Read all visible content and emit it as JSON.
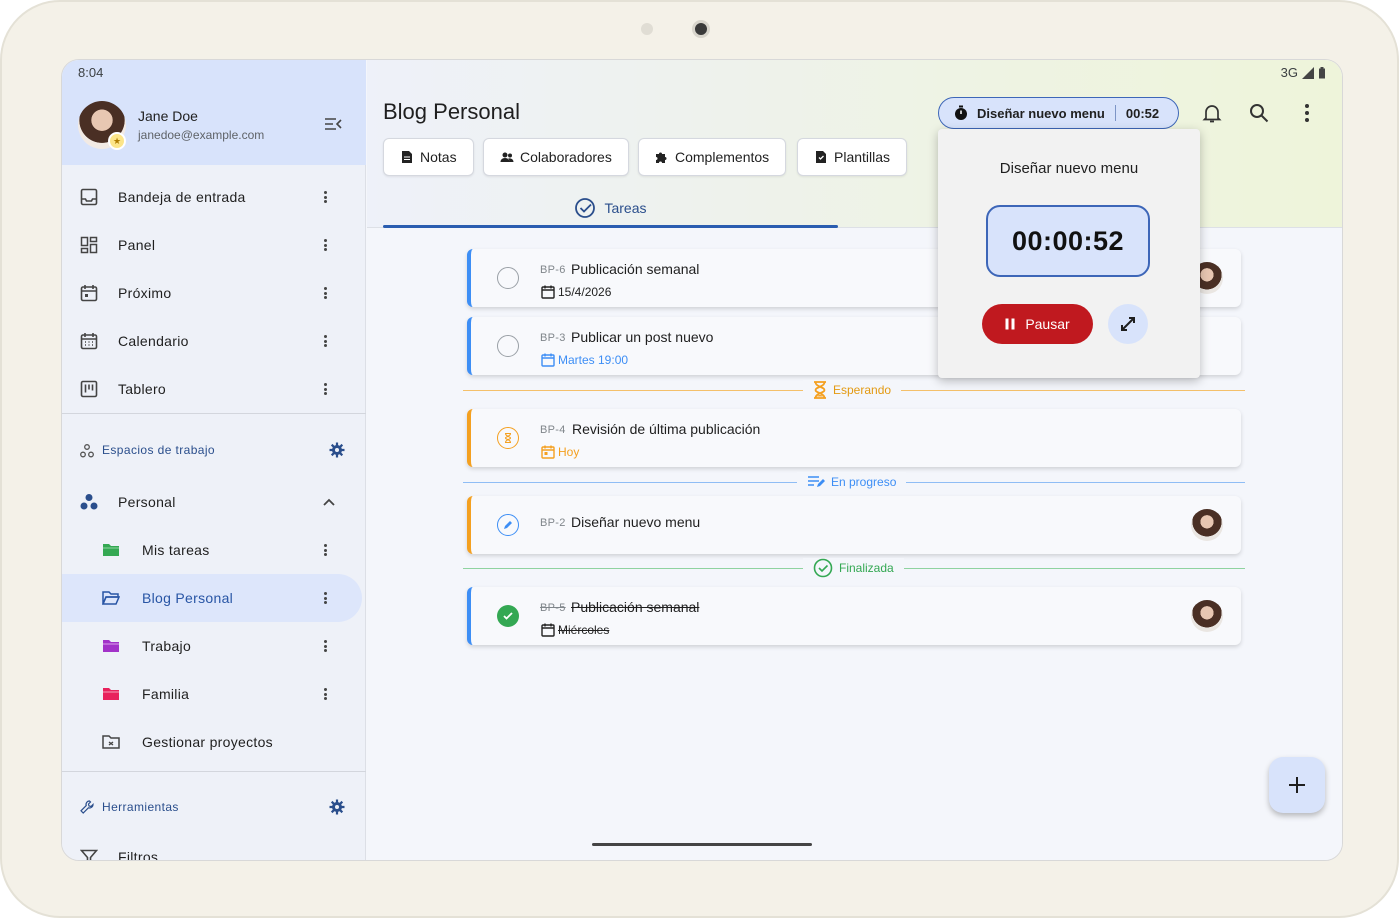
{
  "status": {
    "time": "8:04",
    "network": "3G"
  },
  "user": {
    "name": "Jane Doe",
    "email": "janedoe@example.com"
  },
  "sidebar": {
    "items": [
      {
        "label": "Bandeja de entrada",
        "icon": "inbox-icon"
      },
      {
        "label": "Panel",
        "icon": "dashboard-icon"
      },
      {
        "label": "Próximo",
        "icon": "calendar-upcoming-icon"
      },
      {
        "label": "Calendario",
        "icon": "calendar-icon"
      },
      {
        "label": "Tablero",
        "icon": "board-icon"
      }
    ],
    "workspaces_label": "Espacios de trabajo",
    "workspace": {
      "label": "Personal"
    },
    "projects": [
      {
        "label": "Mis tareas",
        "color": "#34a853"
      },
      {
        "label": "Blog Personal",
        "color": "#2855a5"
      },
      {
        "label": "Trabajo",
        "color": "#a233c9"
      },
      {
        "label": "Familia",
        "color": "#e8225c"
      }
    ],
    "manage_label": "Gestionar proyectos",
    "tools_label": "Herramientas",
    "filters_label": "Filtros"
  },
  "header": {
    "title": "Blog Personal",
    "chips": [
      "Notas",
      "Colaboradores",
      "Complementos",
      "Plantillas"
    ],
    "tab": "Tareas"
  },
  "timer": {
    "pill_task": "Diseñar nuevo menu",
    "pill_time": "00:52",
    "popup_title": "Diseñar nuevo menu",
    "popup_time": "00:00:52",
    "pause_label": "Pausar"
  },
  "groups": {
    "waiting": "Esperando",
    "in_progress": "En progreso",
    "done": "Finalizada"
  },
  "tasks": [
    {
      "code": "BP-6",
      "title": "Publicación semanal",
      "meta": "15/4/2026"
    },
    {
      "code": "BP-3",
      "title": "Publicar un post nuevo",
      "meta": "Martes 19:00"
    },
    {
      "code": "BP-4",
      "title": "Revisión de última publicación",
      "meta": "Hoy"
    },
    {
      "code": "BP-2",
      "title": "Diseñar nuevo menu",
      "meta": ""
    },
    {
      "code": "BP-5",
      "title": "Publicación semanal",
      "meta": "Miércoles"
    }
  ],
  "colors": {
    "accent": "#2855a5",
    "pause": "#c0191f",
    "waiting": "#f4a020",
    "progress": "#3d8ef5",
    "done": "#34a853"
  }
}
